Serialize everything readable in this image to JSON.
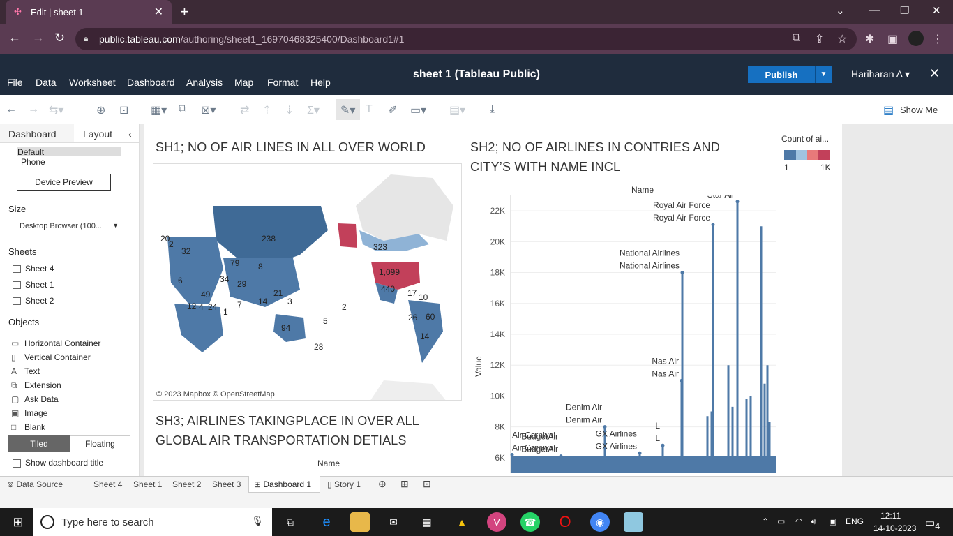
{
  "browser": {
    "tab_title": "Edit | sheet 1",
    "url_domain": "public.tableau.com",
    "url_path": "/authoring/sheet1_16970468325400/Dashboard1#1"
  },
  "app": {
    "title": "sheet 1 (Tableau Public)",
    "menu": [
      "File",
      "Data",
      "Worksheet",
      "Dashboard",
      "Analysis",
      "Map",
      "Format",
      "Help"
    ],
    "publish_label": "Publish",
    "user": "Hariharan A",
    "show_me": "Show Me"
  },
  "left_pane": {
    "tabs": [
      "Dashboard",
      "Layout"
    ],
    "device_options": [
      "Default",
      "Phone"
    ],
    "device_preview": "Device Preview",
    "size_label": "Size",
    "size_value": "Desktop Browser (100...",
    "sheets_label": "Sheets",
    "sheets": [
      "Sheet 4",
      "Sheet 1",
      "Sheet 2"
    ],
    "objects_label": "Objects",
    "objects": [
      "Horizontal Container",
      "Vertical Container",
      "Text",
      "Extension",
      "Ask Data",
      "Image",
      "Blank"
    ],
    "tiled": "Tiled",
    "floating": "Floating",
    "show_title": "Show dashboard title"
  },
  "dashboard": {
    "sh1_title": "SH1;   NO OF AIR  LINES IN ALL OVER WORLD",
    "sh2_title_line1": "SH2; NO OF AIRLINES IN CONTRIES AND",
    "sh2_title_line2": "CITY’S WITH NAME INCL",
    "sh3_title_line1": "SH3; AIRLINES TAKINGPLACE IN OVER ALL",
    "sh3_title_line2": "GLOBAL AIR TRANSPORTATION DETIALS",
    "sh3_name_label": "Name",
    "map_attribution": "© 2023 Mapbox  © OpenStreetMap",
    "map_labels": [
      "238",
      "323",
      "1,099",
      "440",
      "94",
      "60",
      "79",
      "28",
      "21",
      "17",
      "10",
      "14",
      "20",
      "2",
      "32",
      "6",
      "49",
      "34",
      "29",
      "7",
      "3",
      "1",
      "5",
      "2",
      "26",
      "14",
      "8",
      "4",
      "12",
      "24"
    ],
    "legend_title": "Count of ai...",
    "legend_min": "1",
    "legend_max": "1K",
    "legend_colors": [
      "#4e79a7",
      "#a0c3e0",
      "#e8797a",
      "#c2405a"
    ]
  },
  "chart_data": {
    "type": "bar",
    "title": "SH2; NO OF AIRLINES IN CONTRIES AND CITY’S WITH NAME INCL",
    "xlabel": "Name",
    "ylabel": "Value",
    "yticks": [
      "6K",
      "8K",
      "10K",
      "12K",
      "14K",
      "16K",
      "18K",
      "20K",
      "22K"
    ],
    "ylim": [
      5000,
      23000
    ],
    "color": "#4e79a7",
    "annotated": [
      {
        "name": "Air Carnival",
        "value": 6200
      },
      {
        "name": "BudgetAir",
        "value": 6100
      },
      {
        "name": "Denim Air",
        "value": 8000
      },
      {
        "name": "GX Airlines",
        "value": 6300
      },
      {
        "name": "L",
        "value": 6800
      },
      {
        "name": "Nas Air",
        "value": 11000
      },
      {
        "name": "National Airlines",
        "value": 18000
      },
      {
        "name": "Royal Air Force",
        "value": 21100
      },
      {
        "name": "Star Air",
        "value": 22600
      }
    ],
    "other_spikes": [
      8700,
      9000,
      12000,
      9300,
      9800,
      10000,
      21000,
      10800,
      12000,
      8300
    ]
  },
  "bottom_tabs": [
    "Data Source",
    "Sheet 4",
    "Sheet 1",
    "Sheet 2",
    "Sheet 3",
    "Dashboard 1",
    "Story 1"
  ],
  "taskbar": {
    "search_placeholder": "Type here to search",
    "lang": "ENG",
    "time": "12:11",
    "date": "14-10-2023",
    "notifications": "4"
  }
}
